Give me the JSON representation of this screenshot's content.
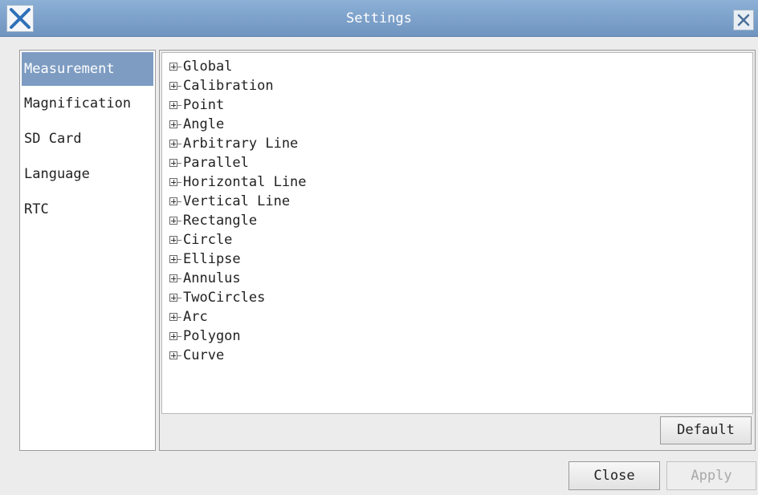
{
  "window": {
    "title": "Settings",
    "accent_color": "#7e9cc2",
    "app_icon": "x-logo-icon",
    "close_icon": "close-icon"
  },
  "sidebar": {
    "selected": "Measurement",
    "items": [
      {
        "label": "Measurement"
      },
      {
        "label": "Magnification"
      },
      {
        "label": "SD Card"
      },
      {
        "label": "Language"
      },
      {
        "label": "RTC"
      }
    ]
  },
  "tree": {
    "expander_icon": "plus-box-icon",
    "items": [
      {
        "label": "Global"
      },
      {
        "label": "Calibration"
      },
      {
        "label": "Point"
      },
      {
        "label": "Angle"
      },
      {
        "label": "Arbitrary Line"
      },
      {
        "label": "Parallel"
      },
      {
        "label": "Horizontal Line"
      },
      {
        "label": "Vertical Line"
      },
      {
        "label": "Rectangle"
      },
      {
        "label": "Circle"
      },
      {
        "label": "Ellipse"
      },
      {
        "label": "Annulus"
      },
      {
        "label": "TwoCircles"
      },
      {
        "label": "Arc"
      },
      {
        "label": "Polygon"
      },
      {
        "label": "Curve"
      }
    ]
  },
  "buttons": {
    "default_label": "Default",
    "close_label": "Close",
    "apply_label": "Apply",
    "apply_enabled": false
  }
}
